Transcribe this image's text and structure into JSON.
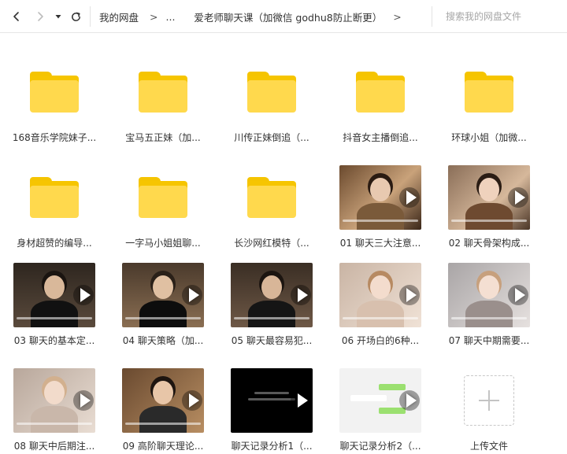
{
  "toolbar": {
    "icons": {
      "back": "chevron-left-icon",
      "forward": "chevron-right-icon",
      "history": "caret-down-icon",
      "refresh": "refresh-icon"
    },
    "breadcrumb": {
      "root": "我的网盘",
      "sep": ">",
      "ellipsis": "...",
      "current": "爱老师聊天课（加微信 godhu8防止断更）"
    },
    "search": {
      "placeholder": "搜索我的网盘文件",
      "value": ""
    }
  },
  "items": [
    {
      "type": "folder",
      "label": "168音乐学院妹子..."
    },
    {
      "type": "folder",
      "label": "宝马五正妹（加..."
    },
    {
      "type": "folder",
      "label": "川传正妹倒追（..."
    },
    {
      "type": "folder",
      "label": "抖音女主播倒追..."
    },
    {
      "type": "folder",
      "label": "环球小姐（加微..."
    },
    {
      "type": "folder",
      "label": "身材超赞的编导..."
    },
    {
      "type": "folder",
      "label": "一字马小姐姐聊..."
    },
    {
      "type": "folder",
      "label": "长沙网红模特（..."
    },
    {
      "type": "video",
      "label": "01 聊天三大注意..."
    },
    {
      "type": "video",
      "label": "02 聊天骨架构成..."
    },
    {
      "type": "video",
      "label": "03 聊天的基本定..."
    },
    {
      "type": "video",
      "label": "04 聊天策略（加..."
    },
    {
      "type": "video",
      "label": "05 聊天最容易犯..."
    },
    {
      "type": "video",
      "label": "06 开场白的6种..."
    },
    {
      "type": "video",
      "label": "07 聊天中期需要..."
    },
    {
      "type": "video",
      "label": "08 聊天中后期注..."
    },
    {
      "type": "video",
      "label": "09 高阶聊天理论..."
    },
    {
      "type": "video",
      "label": "聊天记录分析1（..."
    },
    {
      "type": "video",
      "label": "聊天记录分析2（..."
    },
    {
      "type": "upload",
      "label": "上传文件"
    }
  ]
}
